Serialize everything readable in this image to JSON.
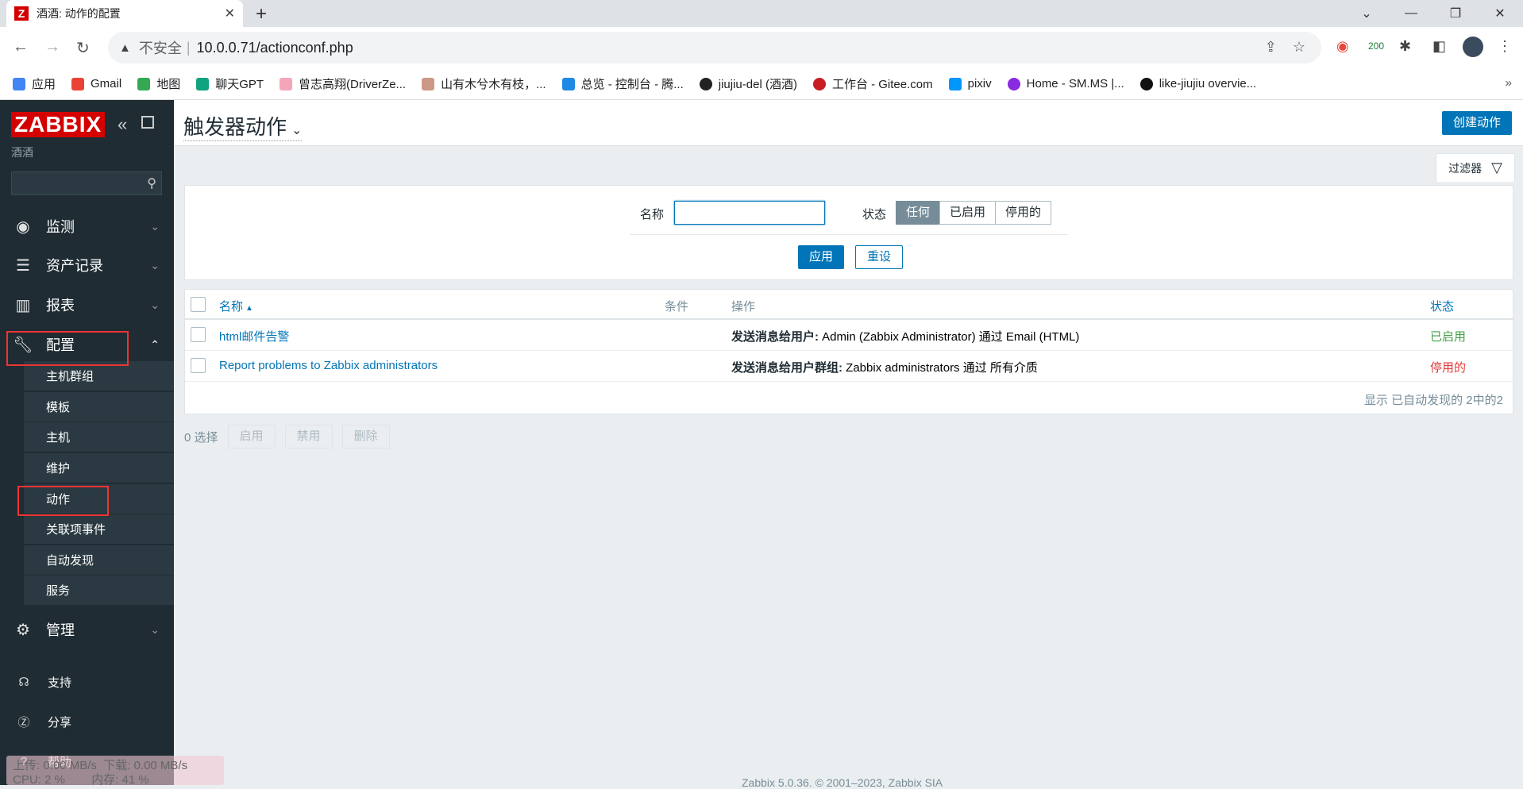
{
  "browser": {
    "tab_title": "酒酒: 动作的配置",
    "tab_favicon": "Z",
    "url_warning": "不安全",
    "url": "10.0.0.71/actionconf.php",
    "ext_badge": "200",
    "bookmarks": [
      {
        "label": "应用",
        "icon": "apps-icon",
        "color": "#4285f4"
      },
      {
        "label": "Gmail",
        "icon": "gmail-icon",
        "color": "#ea4335"
      },
      {
        "label": "地图",
        "icon": "maps-icon",
        "color": "#34a853"
      },
      {
        "label": "聊天GPT",
        "icon": "chatgpt-icon",
        "color": "#10a37f"
      },
      {
        "label": "曾志高翔(DriverZe...",
        "icon": "flower-icon",
        "color": "#f4a6b8"
      },
      {
        "label": "山有木兮木有枝，...",
        "icon": "image-icon",
        "color": "#c98"
      },
      {
        "label": "总览 - 控制台 - 腾...",
        "icon": "cloud-icon",
        "color": "#1e88e5"
      },
      {
        "label": "jiujiu-del (酒酒)",
        "icon": "github-icon",
        "color": "#222"
      },
      {
        "label": "工作台 - Gitee.com",
        "icon": "gitee-icon",
        "color": "#c71d23"
      },
      {
        "label": "pixiv",
        "icon": "pixiv-icon",
        "color": "#0096fa"
      },
      {
        "label": "Home - SM.MS |...",
        "icon": "smms-icon",
        "color": "#8a2be2"
      },
      {
        "label": "like-jiujiu overvie...",
        "icon": "vercel-icon",
        "color": "#111"
      }
    ]
  },
  "sidebar": {
    "logo": "ZABBIX",
    "server_name": "酒酒",
    "menu": {
      "monitoring": "监测",
      "inventory": "资产记录",
      "reports": "报表",
      "configuration": "配置",
      "administration": "管理"
    },
    "submenu": [
      "主机群组",
      "模板",
      "主机",
      "维护",
      "动作",
      "关联项事件",
      "自动发现",
      "服务"
    ],
    "footer": {
      "support": "支持",
      "share": "分享",
      "help": "帮助"
    }
  },
  "header": {
    "title": "触发器动作",
    "create_button": "创建动作"
  },
  "filter": {
    "tab_label": "过滤器",
    "name_label": "名称",
    "name_value": "",
    "status_label": "状态",
    "status_options": [
      "任何",
      "已启用",
      "停用的"
    ],
    "status_selected": "任何",
    "apply_button": "应用",
    "reset_button": "重设"
  },
  "table": {
    "columns": {
      "name": "名称",
      "sort_indicator": "▲",
      "conditions": "条件",
      "operations": "操作",
      "status": "状态"
    },
    "rows": [
      {
        "name": "html邮件告警",
        "conditions": "",
        "op_label": "发送消息给用户:",
        "op_detail": "Admin (Zabbix Administrator) 通过 Email (HTML)",
        "status": "已启用"
      },
      {
        "name": "Report problems to Zabbix administrators",
        "conditions": "",
        "op_label": "发送消息给用户群组:",
        "op_detail": "Zabbix administrators 通过 所有介质",
        "status": "停用的"
      }
    ],
    "summary": "显示 已自动发现的 2中的2"
  },
  "mass_actions": {
    "selected": "0 选择",
    "enable": "启用",
    "disable": "禁用",
    "delete": "删除"
  },
  "page_footer": "Zabbix 5.0.36. © 2001–2023, Zabbix SIA",
  "net_monitor": {
    "upload": "上传: 0.00 MB/s",
    "download": "下载: 0.00 MB/s",
    "cpu": "CPU: 2 %",
    "mem": "内存: 41 %"
  }
}
